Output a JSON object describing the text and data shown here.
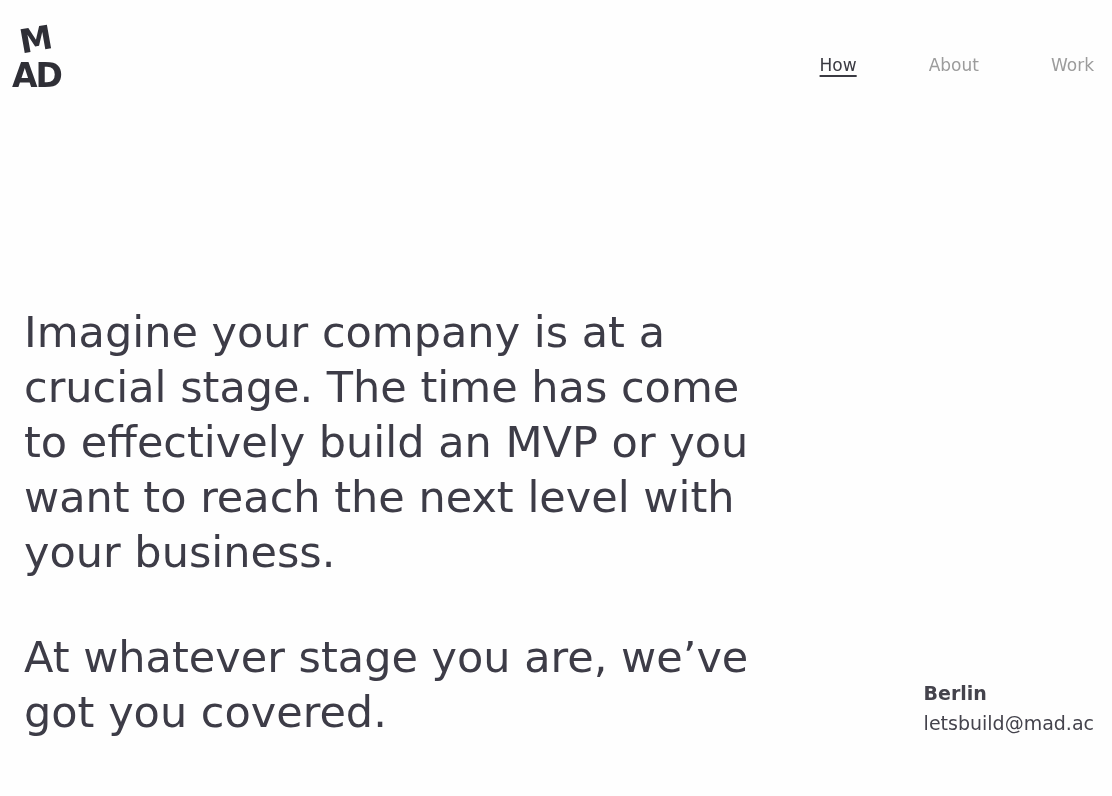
{
  "logo": {
    "lines": [
      "M",
      "AD"
    ]
  },
  "nav": [
    {
      "label": "How",
      "selected": true
    },
    {
      "label": "About",
      "selected": false
    },
    {
      "label": "Work",
      "selected": false
    }
  ],
  "intro": {
    "paragraphs": [
      "Imagine your company is at a crucial stage. The time has come to effectively build an MVP or you want to reach the next level with your business.",
      "At whatever stage you are, we’ve got you covered."
    ]
  },
  "contact": {
    "city": "Berlin",
    "email": "letsbuild@mad.ac"
  }
}
